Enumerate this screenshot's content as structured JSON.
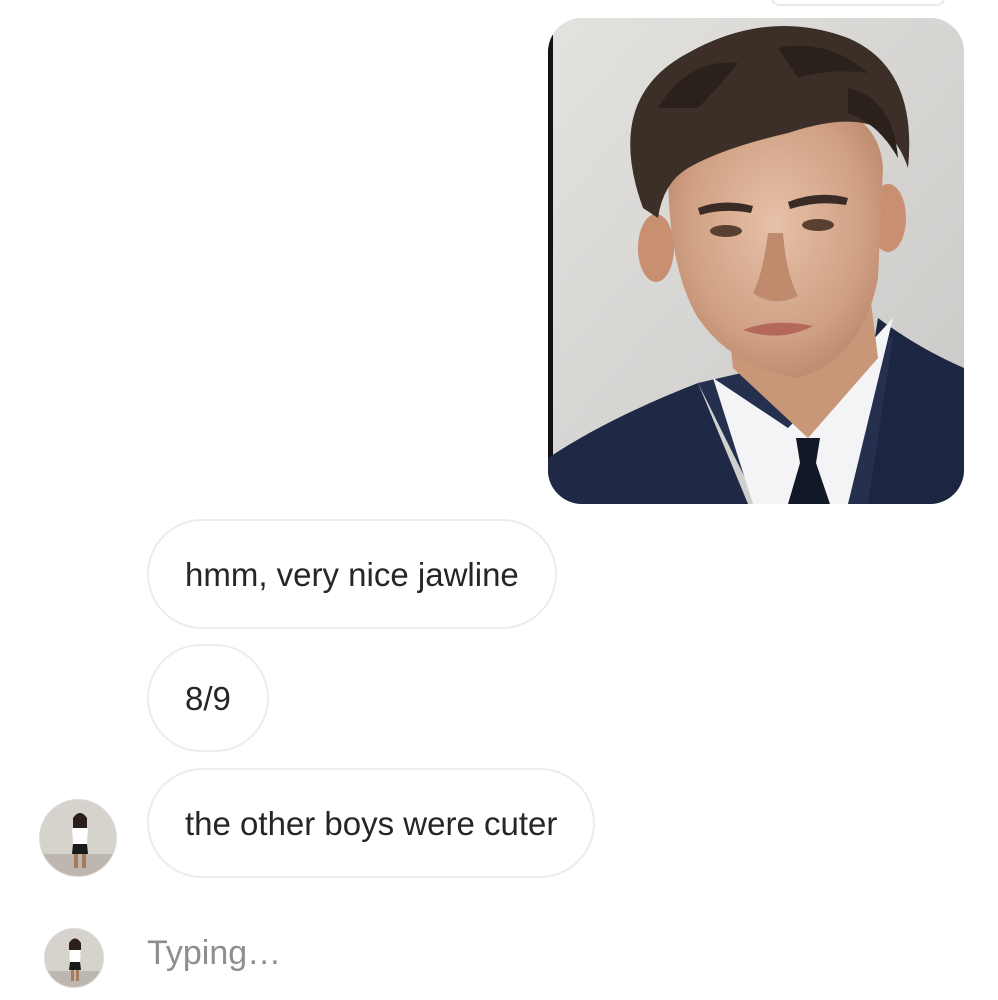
{
  "thread": {
    "sent_photo": {
      "icon": "photo-of-man-in-suit"
    },
    "messages": [
      {
        "text": "hmm, very nice jawline"
      },
      {
        "text": "8/9"
      },
      {
        "text": "the other boys were cuter"
      }
    ],
    "typing_indicator": "Typing…",
    "contact_avatar": {
      "icon": "avatar-woman-photo"
    }
  },
  "colors": {
    "background": "#ffffff",
    "bubble_border": "#ececec",
    "message_text": "#262626",
    "typing_text": "#8e8e8e"
  }
}
